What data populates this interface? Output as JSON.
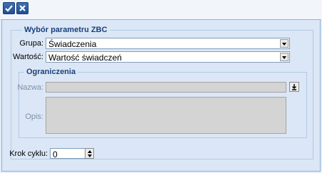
{
  "toolbar": {
    "accept_icon": "checkmark-icon",
    "cancel_icon": "close-icon"
  },
  "param_group": {
    "title": "Wybór parametru ZBC",
    "grupa_label": "Grupa:",
    "grupa_value": "Świadczenia",
    "wartosc_label": "Wartość:",
    "wartosc_value": "Wartość świadczeń"
  },
  "limits_group": {
    "title": "Ograniczenia",
    "nazwa_label": "Nazwa:",
    "opis_label": "Opis:",
    "nazwa_button_icon": "download-arrow-icon"
  },
  "cycle": {
    "label": "Krok cyklu:",
    "value": "0"
  }
}
